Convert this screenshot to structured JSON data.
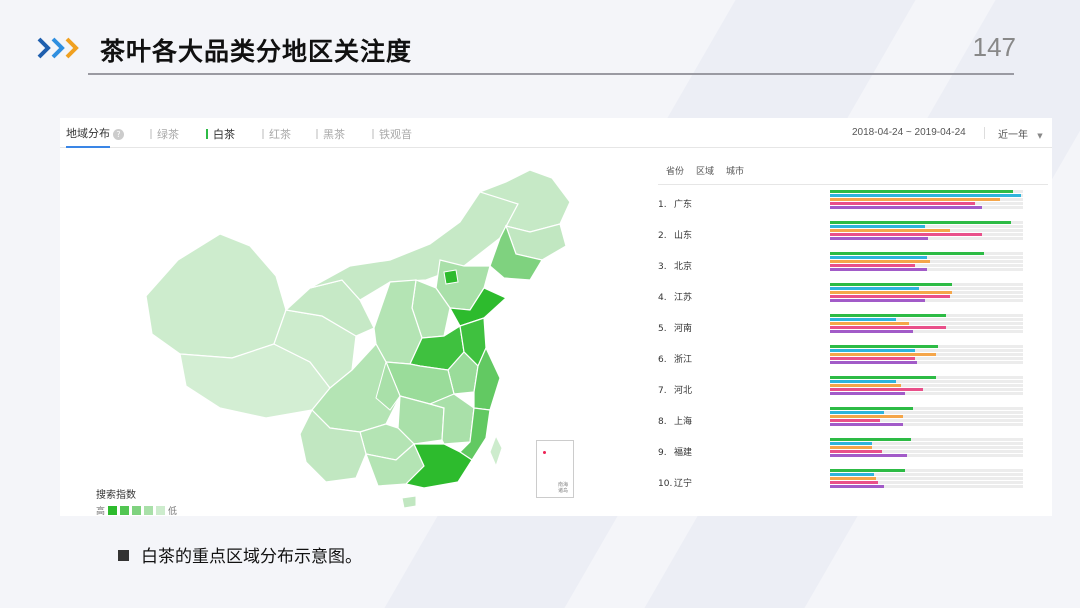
{
  "slide": {
    "title": "茶叶各大品类分地区关注度",
    "page_number": "147",
    "caption": "白茶的重点区域分布示意图。"
  },
  "panel": {
    "section_title": "地域分布",
    "help_icon": "question-circle-icon",
    "tabs": [
      {
        "label": "绿茶",
        "active": false
      },
      {
        "label": "白茶",
        "active": true
      },
      {
        "label": "红茶",
        "active": false
      },
      {
        "label": "黑茶",
        "active": false
      },
      {
        "label": "铁观音",
        "active": false
      }
    ],
    "date_range": "2018-04-24 ~ 2019-04-24",
    "period": "近一年",
    "period_icon": "caret-down-icon"
  },
  "legend": {
    "title": "搜索指数",
    "high": "高",
    "low": "低",
    "colors": [
      "#2dbb2d",
      "#52c652",
      "#7fd27f",
      "#a9e0a9",
      "#cdeccd"
    ]
  },
  "map": {
    "inset_label": "南海诸岛"
  },
  "ranking": {
    "headers": [
      "省份",
      "区域",
      "城市"
    ],
    "bar_colors": [
      "#2dbb45",
      "#2fb4dc",
      "#f5a64a",
      "#e9508a",
      "#a25bc8"
    ],
    "rows": [
      {
        "rank": "1.",
        "name": "广东",
        "bars": [
          0.95,
          0.99,
          0.88,
          0.75,
          0.79
        ]
      },
      {
        "rank": "2.",
        "name": "山东",
        "bars": [
          0.94,
          0.49,
          0.62,
          0.79,
          0.51
        ]
      },
      {
        "rank": "3.",
        "name": "北京",
        "bars": [
          0.8,
          0.5,
          0.52,
          0.44,
          0.5
        ]
      },
      {
        "rank": "4.",
        "name": "江苏",
        "bars": [
          0.63,
          0.46,
          0.63,
          0.62,
          0.49
        ]
      },
      {
        "rank": "5.",
        "name": "河南",
        "bars": [
          0.6,
          0.34,
          0.41,
          0.6,
          0.43
        ]
      },
      {
        "rank": "6.",
        "name": "浙江",
        "bars": [
          0.56,
          0.44,
          0.55,
          0.44,
          0.45
        ]
      },
      {
        "rank": "7.",
        "name": "河北",
        "bars": [
          0.55,
          0.34,
          0.37,
          0.48,
          0.39
        ]
      },
      {
        "rank": "8.",
        "name": "上海",
        "bars": [
          0.43,
          0.28,
          0.38,
          0.26,
          0.38
        ]
      },
      {
        "rank": "9.",
        "name": "福建",
        "bars": [
          0.42,
          0.22,
          0.22,
          0.27,
          0.4
        ]
      },
      {
        "rank": "10.",
        "name": "辽宁",
        "bars": [
          0.39,
          0.23,
          0.24,
          0.25,
          0.28
        ]
      }
    ]
  }
}
